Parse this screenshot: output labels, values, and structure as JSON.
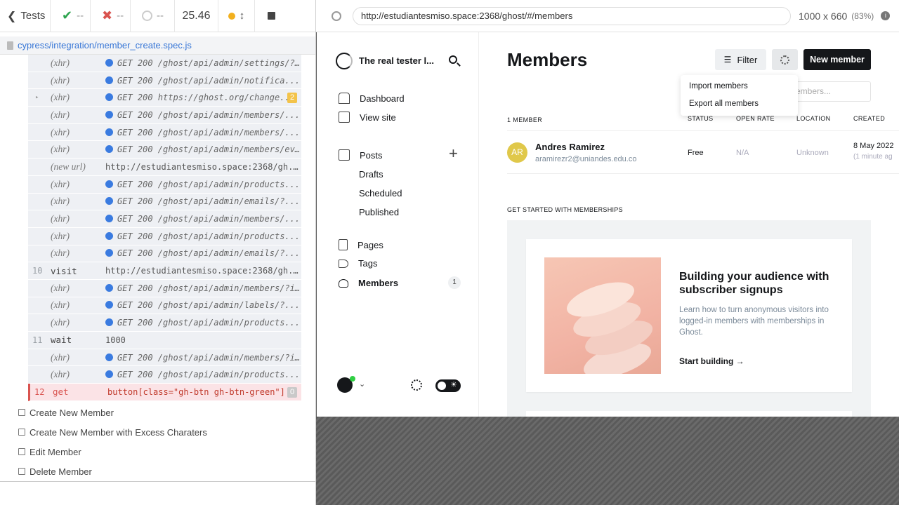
{
  "runner": {
    "back_label": "Tests",
    "passed": "--",
    "failed": "--",
    "pending": "--",
    "duration": "25.46",
    "spec_path": "cypress/integration/member_create.spec.js"
  },
  "commands": [
    {
      "num": "",
      "name": "(xhr)",
      "msg": "GET 200 /ghost/api/admin/settings/?group..."
    },
    {
      "num": "",
      "name": "(xhr)",
      "msg": "GET 200 /ghost/api/admin/notifica..."
    },
    {
      "num": "",
      "name": "(xhr)",
      "msg": "GET 200 https://ghost.org/change...",
      "badge": "2"
    },
    {
      "num": "",
      "name": "(xhr)",
      "msg": "GET 200 /ghost/api/admin/members/..."
    },
    {
      "num": "",
      "name": "(xhr)",
      "msg": "GET 200 /ghost/api/admin/members/..."
    },
    {
      "num": "",
      "name": "(xhr)",
      "msg": "GET 200 /ghost/api/admin/members/events/..."
    },
    {
      "num": "",
      "name": "(new url)",
      "msg": "http://estudiantesmiso.space:2368/gh..."
    },
    {
      "num": "",
      "name": "(xhr)",
      "msg": "GET 200 /ghost/api/admin/products..."
    },
    {
      "num": "",
      "name": "(xhr)",
      "msg": "GET 200 /ghost/api/admin/emails/?..."
    },
    {
      "num": "",
      "name": "(xhr)",
      "msg": "GET 200 /ghost/api/admin/members/..."
    },
    {
      "num": "",
      "name": "(xhr)",
      "msg": "GET 200 /ghost/api/admin/products..."
    },
    {
      "num": "",
      "name": "(xhr)",
      "msg": "GET 200 /ghost/api/admin/emails/?..."
    },
    {
      "num": "10",
      "name": "visit",
      "msg": "http://estudiantesmiso.space:2368/gh..."
    },
    {
      "num": "",
      "name": "(xhr)",
      "msg": "GET 200 /ghost/api/admin/members/?includ..."
    },
    {
      "num": "",
      "name": "(xhr)",
      "msg": "GET 200 /ghost/api/admin/labels/?..."
    },
    {
      "num": "",
      "name": "(xhr)",
      "msg": "GET 200 /ghost/api/admin/products..."
    },
    {
      "num": "11",
      "name": "wait",
      "msg": "1000"
    },
    {
      "num": "",
      "name": "(xhr)",
      "msg": "GET 200 /ghost/api/admin/members/?includ..."
    },
    {
      "num": "",
      "name": "(xhr)",
      "msg": "GET 200 /ghost/api/admin/products..."
    },
    {
      "num": "12",
      "name": "get",
      "msg": "button[class=\"gh-btn gh-btn-green\"]",
      "badge": "0"
    }
  ],
  "tests": [
    {
      "label": "Create New Member"
    },
    {
      "label": "Create New Member with Excess Charaters"
    },
    {
      "label": "Edit Member"
    },
    {
      "label": "Delete Member"
    }
  ],
  "browser": {
    "url": "http://estudiantesmiso.space:2368/ghost/#/members",
    "viewport": "1000 x 660",
    "zoom": "(83%)"
  },
  "ghost": {
    "site_title": "The real tester l...",
    "nav": {
      "dashboard": "Dashboard",
      "view_site": "View site",
      "posts": "Posts",
      "drafts": "Drafts",
      "scheduled": "Scheduled",
      "published": "Published",
      "pages": "Pages",
      "tags": "Tags",
      "members": "Members",
      "members_count": "1"
    },
    "page_title": "Members",
    "filter_label": "Filter",
    "new_member_label": "New member",
    "dropdown": {
      "import": "Import members",
      "export": "Export all members"
    },
    "search_placeholder": "embers...",
    "table": {
      "count_label": "1 MEMBER",
      "headers": [
        "STATUS",
        "OPEN RATE",
        "LOCATION",
        "CREATED"
      ],
      "row": {
        "initials": "AR",
        "name": "Andres Ramirez",
        "email": "aramirezr2@uniandes.edu.co",
        "status": "Free",
        "open_rate": "N/A",
        "location": "Unknown",
        "created": "8 May 2022",
        "created_rel": "(1 minute ag"
      }
    },
    "memberships": {
      "section_title": "GET STARTED WITH MEMBERSHIPS",
      "card_title": "Building your audience with subscriber signups",
      "card_text": "Learn how to turn anonymous visitors into logged-in members with memberships in Ghost.",
      "card_link": "Start building →"
    }
  },
  "colors": {
    "accent": "#15171a",
    "link": "#3776d6",
    "error": "#d9534f",
    "avatar": "#e0c84a"
  }
}
